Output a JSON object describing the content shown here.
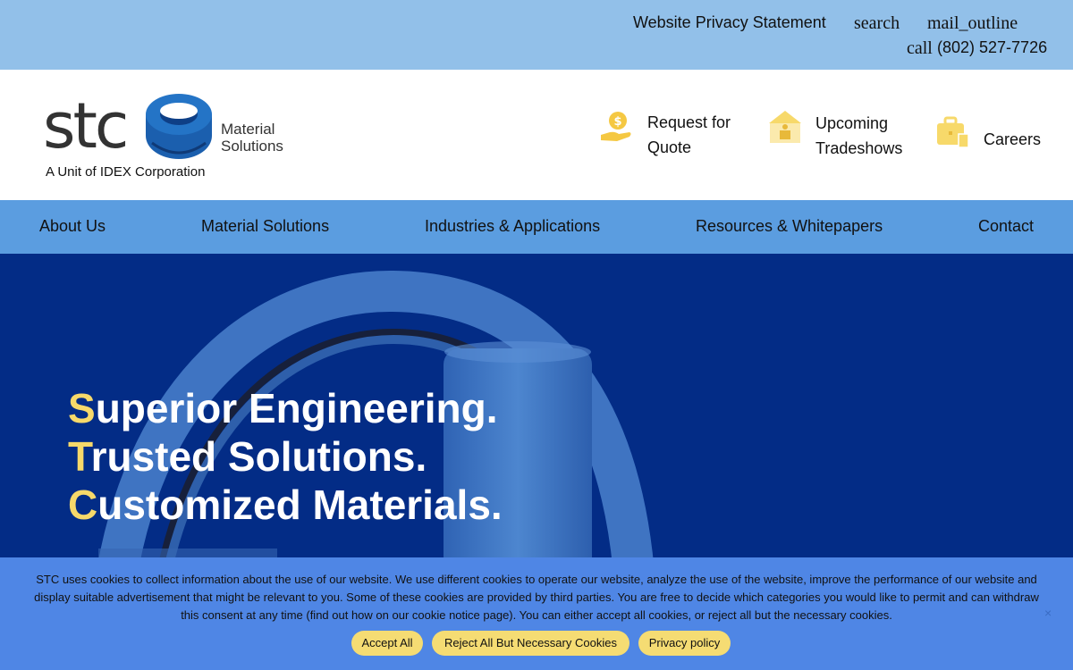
{
  "utility": {
    "privacy_label": "Website Privacy Statement",
    "search_icon": "search",
    "mail_icon": "mail_outline",
    "call_icon": "call",
    "phone": "(802) 527-7726"
  },
  "logo": {
    "brand": "stc",
    "tagline_line1": "Material",
    "tagline_line2": "Solutions",
    "unit": "A Unit of IDEX Corporation"
  },
  "quick_links": {
    "quote": {
      "label": "Request for Quote",
      "icon": "money-hand-icon"
    },
    "tradeshows": {
      "label": "Upcoming Tradeshows",
      "icon": "booth-icon"
    },
    "careers": {
      "label": "Careers",
      "icon": "briefcase-icon"
    }
  },
  "nav": {
    "about": "About Us",
    "material": "Material Solutions",
    "industries": "Industries & Applications",
    "resources": "Resources & Whitepapers",
    "contact": "Contact"
  },
  "hero": {
    "line1_initial": "S",
    "line1_rest": "uperior Engineering.",
    "line2_initial": "T",
    "line2_rest": "rusted Solutions.",
    "line3_initial": "C",
    "line3_rest": "ustomized Materials."
  },
  "cookie": {
    "text": "STC uses cookies to collect information about the use of our website. We use different cookies to operate our website, analyze the use of the website, improve the performance of our website and display suitable advertisement that might be relevant to you. Some of these cookies are provided by third parties. You are free to decide which categories you would like to permit and can withdraw this consent at any time (find out how on our cookie notice page). You can either accept all cookies, or reject all but the necessary cookies.",
    "close": "×",
    "accept": "Accept All",
    "reject": "Reject All But Necessary Cookies",
    "privacy": "Privacy policy"
  },
  "colors": {
    "utility_bar": "#92c0e9",
    "nav_bar": "#5b9de0",
    "hero_bg": "#032c86",
    "accent_yellow": "#f7d96a",
    "cookie_bg": "#4f86e5",
    "button_bg": "#f5dc73"
  }
}
